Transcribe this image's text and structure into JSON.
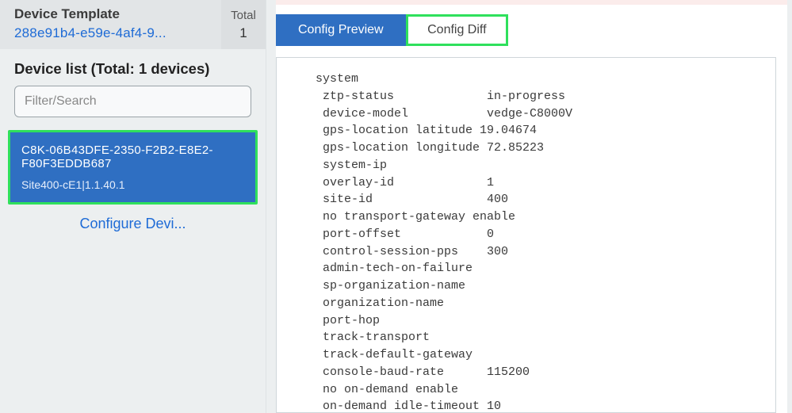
{
  "template": {
    "label": "Device Template",
    "value": "288e91b4-e59e-4af4-9...",
    "total_label": "Total",
    "total_value": "1"
  },
  "device_list": {
    "title": "Device list (Total: 1 devices)",
    "search_placeholder": "Filter/Search"
  },
  "device_card": {
    "id": "C8K-06B43DFE-2350-F2B2-E8E2-F80F3EDDB687",
    "sub": "Site400-cE1|1.1.40.1"
  },
  "configure_link": "Configure Devi...",
  "tabs": {
    "preview": "Config Preview",
    "diff": "Config Diff"
  },
  "config_text": " system\n  ztp-status             in-progress\n  device-model           vedge-C8000V\n  gps-location latitude 19.04674\n  gps-location longitude 72.85223\n  system-ip\n  overlay-id             1\n  site-id                400\n  no transport-gateway enable\n  port-offset            0\n  control-session-pps    300\n  admin-tech-on-failure\n  sp-organization-name\n  organization-name\n  port-hop\n  track-transport\n  track-default-gateway\n  console-baud-rate      115200\n  no on-demand enable\n  on-demand idle-timeout 10"
}
